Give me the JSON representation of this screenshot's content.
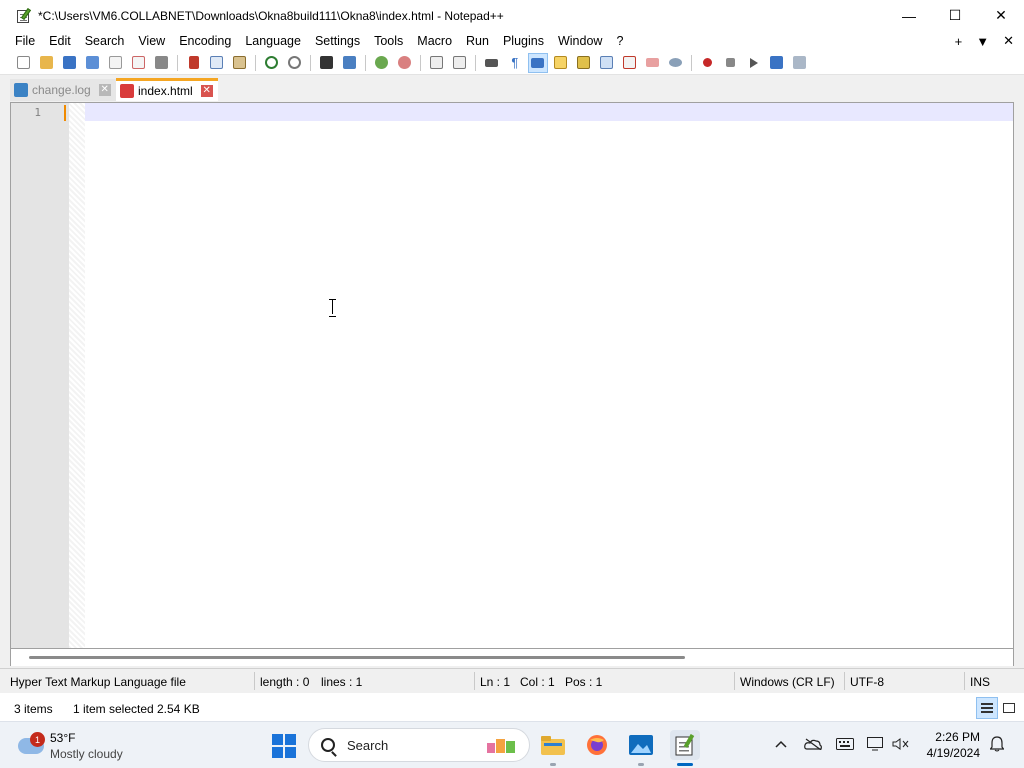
{
  "window": {
    "title": "*C:\\Users\\VM6.COLLABNET\\Downloads\\Okna8build111\\Okna8\\index.html - Notepad++",
    "minimize": "—",
    "maximize": "☐",
    "close": "✕"
  },
  "menu": {
    "items": [
      "File",
      "Edit",
      "Search",
      "View",
      "Encoding",
      "Language",
      "Settings",
      "Tools",
      "Macro",
      "Run",
      "Plugins",
      "Window",
      "?"
    ],
    "right": {
      "plus": "+",
      "dropdown": "▼",
      "close": "✕"
    }
  },
  "toolbar": {
    "icons": [
      "new-file-icon",
      "open-file-icon",
      "save-icon",
      "save-all-icon",
      "close-icon",
      "close-all-icon",
      "print-icon",
      "cut-icon",
      "copy-icon",
      "paste-icon",
      "undo-icon",
      "redo-icon",
      "find-icon",
      "replace-icon",
      "zoom-in-icon",
      "zoom-out-icon",
      "sync-vertical-icon",
      "sync-horizontal-icon",
      "word-wrap-icon",
      "show-all-chars-icon",
      "indent-guide-icon",
      "udl-icon",
      "doc-map-icon",
      "function-list-icon",
      "folder-workspace-icon",
      "monitor-icon",
      "eye-icon",
      "record-macro-icon",
      "stop-macro-icon",
      "play-macro-icon",
      "run-macro-multiple-icon",
      "save-macro-icon"
    ]
  },
  "tabs": [
    {
      "label": "change.log",
      "close": "✕"
    },
    {
      "label": "index.html",
      "close": "✕"
    }
  ],
  "editor": {
    "line_numbers": [
      "1"
    ]
  },
  "status": {
    "language": "Hyper Text Markup Language file",
    "length": "length : 0",
    "lines": "lines : 1",
    "ln": "Ln : 1",
    "col": "Col : 1",
    "pos": "Pos : 1",
    "eol": "Windows (CR LF)",
    "encoding": "UTF-8",
    "mode": "INS"
  },
  "explorer": {
    "items_count": "3 items",
    "selected": "1 item selected",
    "size": "2.54 KB"
  },
  "taskbar": {
    "weather_badge": "1",
    "temperature": "53°F",
    "condition": "Mostly cloudy",
    "search_placeholder": "Search",
    "time": "2:26 PM",
    "date": "4/19/2024"
  }
}
